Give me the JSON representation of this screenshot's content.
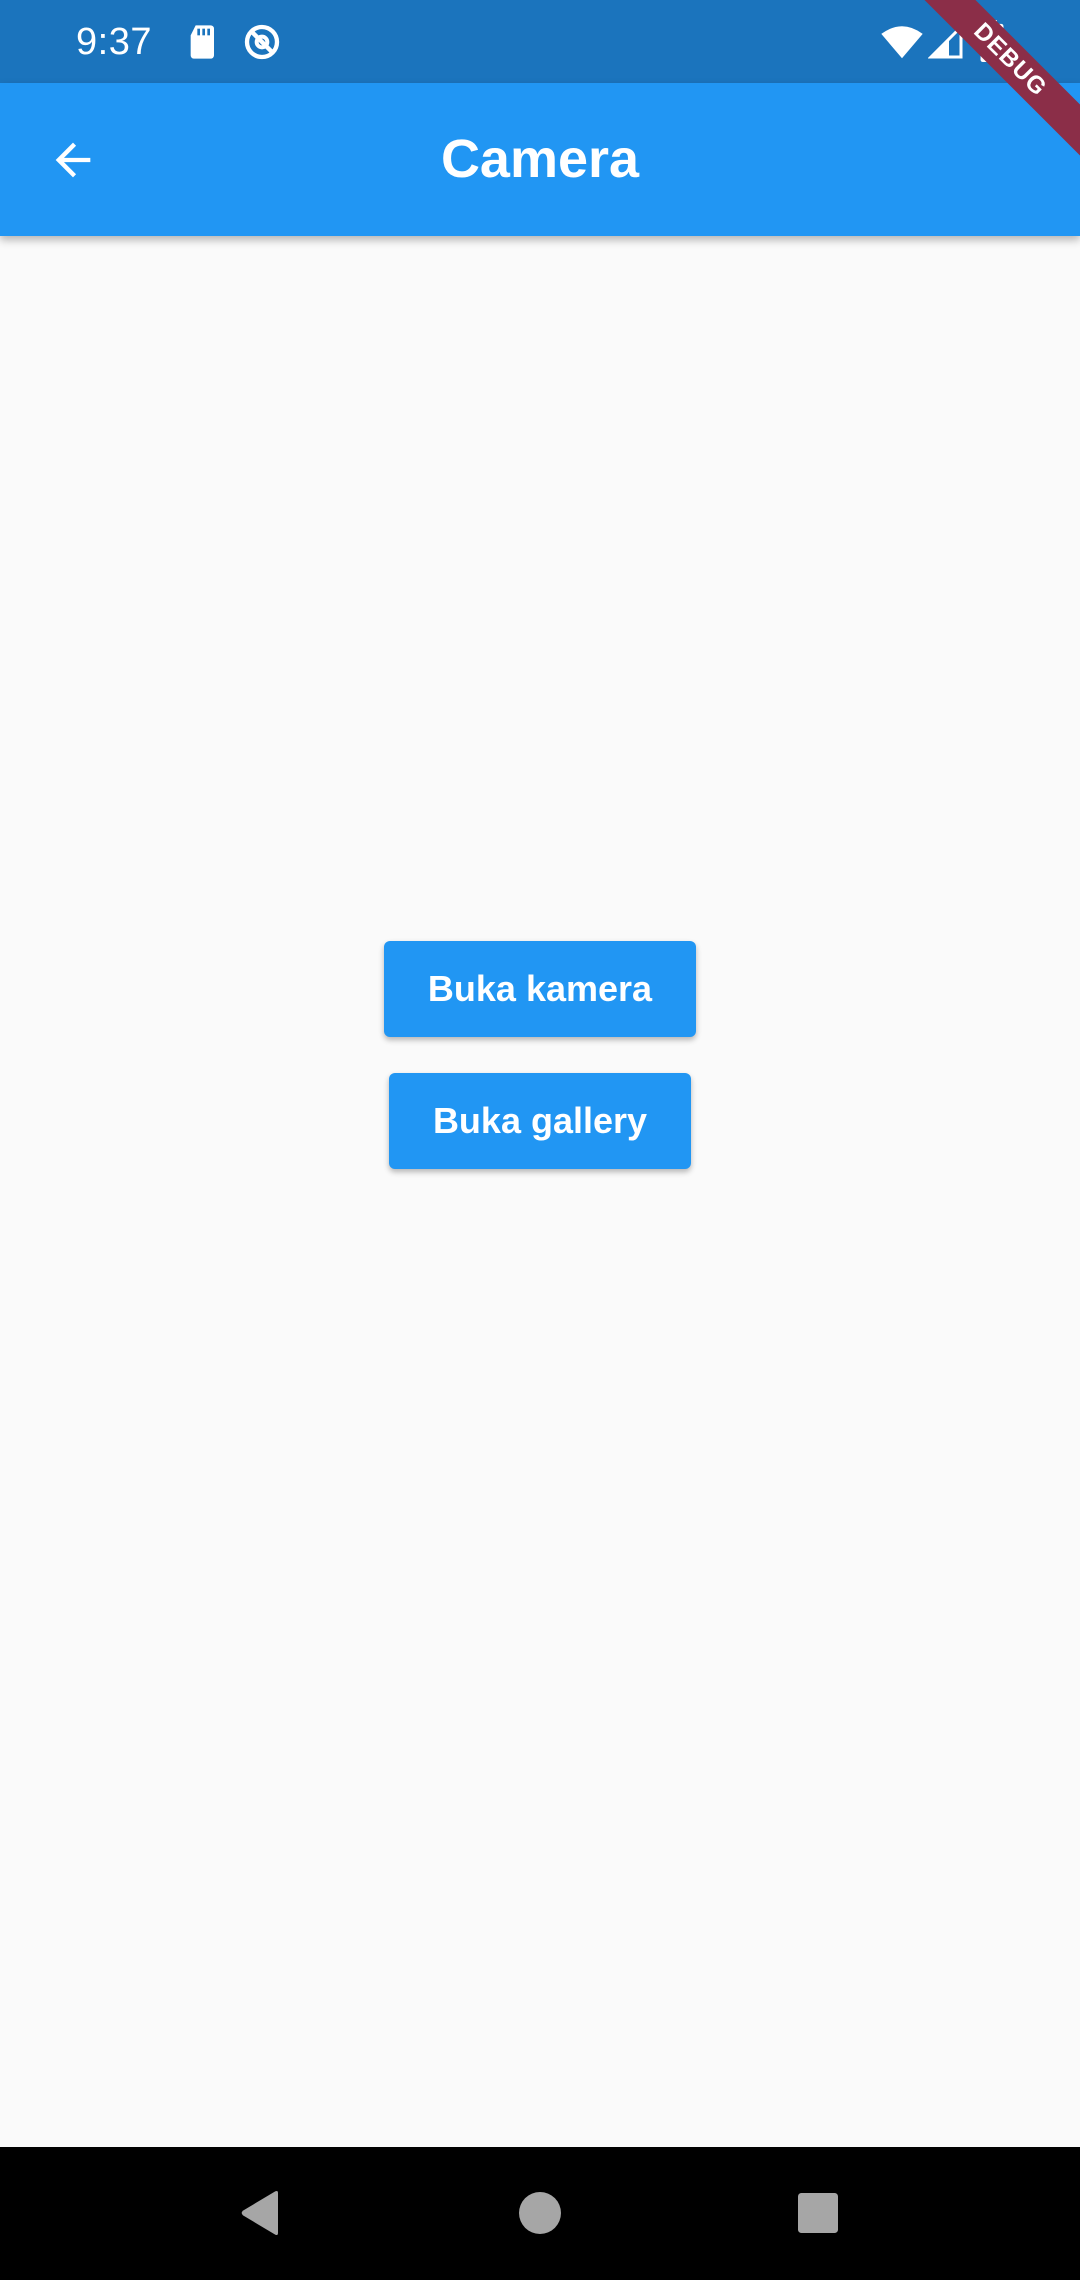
{
  "status_bar": {
    "time": "9:37",
    "icons": [
      "sd-card-icon",
      "sync-icon",
      "wifi-icon",
      "signal-icon",
      "battery-icon"
    ]
  },
  "app_bar": {
    "title": "Camera",
    "back_icon": "arrow-back-icon"
  },
  "debug_banner": {
    "label": "DEBUG"
  },
  "main": {
    "buttons": [
      {
        "label": "Buka kamera"
      },
      {
        "label": "Buka gallery"
      }
    ]
  },
  "nav_bar": {
    "icons": [
      "nav-back-icon",
      "nav-home-icon",
      "nav-recents-icon"
    ]
  },
  "colors": {
    "status_bar": "#1b74bd",
    "app_bar": "#2196f3",
    "button": "#2196f3",
    "background": "#fafafa",
    "debug_ribbon": "#8b2e48",
    "nav_bar": "#000000"
  }
}
